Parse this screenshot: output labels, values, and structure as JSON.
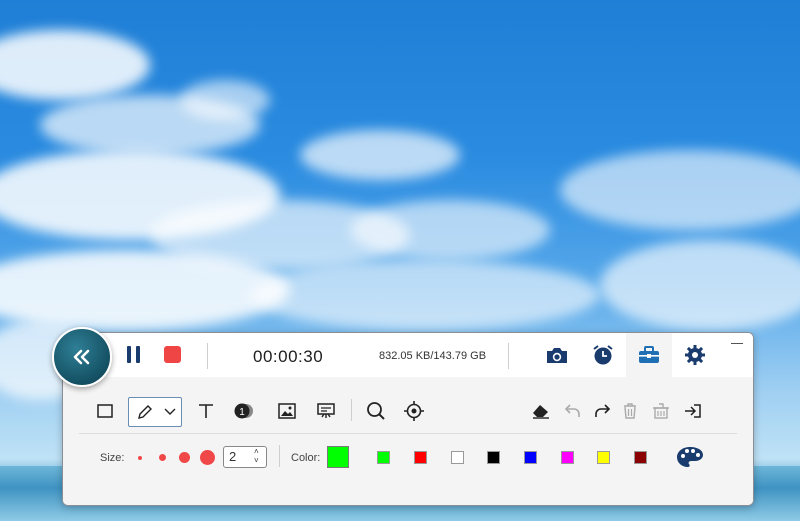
{
  "recorder": {
    "timer": "00:00:30",
    "storage": "832.05 KB/143.79 GB"
  },
  "icons": {
    "collapse": "double-chevron-left-icon",
    "pause": "pause-icon",
    "stop": "stop-icon",
    "screenshot": "camera-icon",
    "schedule": "alarm-clock-icon",
    "toolbox": "toolbox-icon",
    "settings": "gear-icon",
    "minimize": "minimize-icon"
  },
  "toolbar": {
    "size_label": "Size:",
    "size_value": "2",
    "color_label": "Color:"
  },
  "colors": {
    "accent": "#1a3b6e",
    "selected": "#00ff00",
    "swatches": [
      "#00ff00",
      "#ff0000",
      "#ffffff",
      "#000000",
      "#0000ff",
      "#ff00ff",
      "#ffff00",
      "#8b0000"
    ]
  }
}
